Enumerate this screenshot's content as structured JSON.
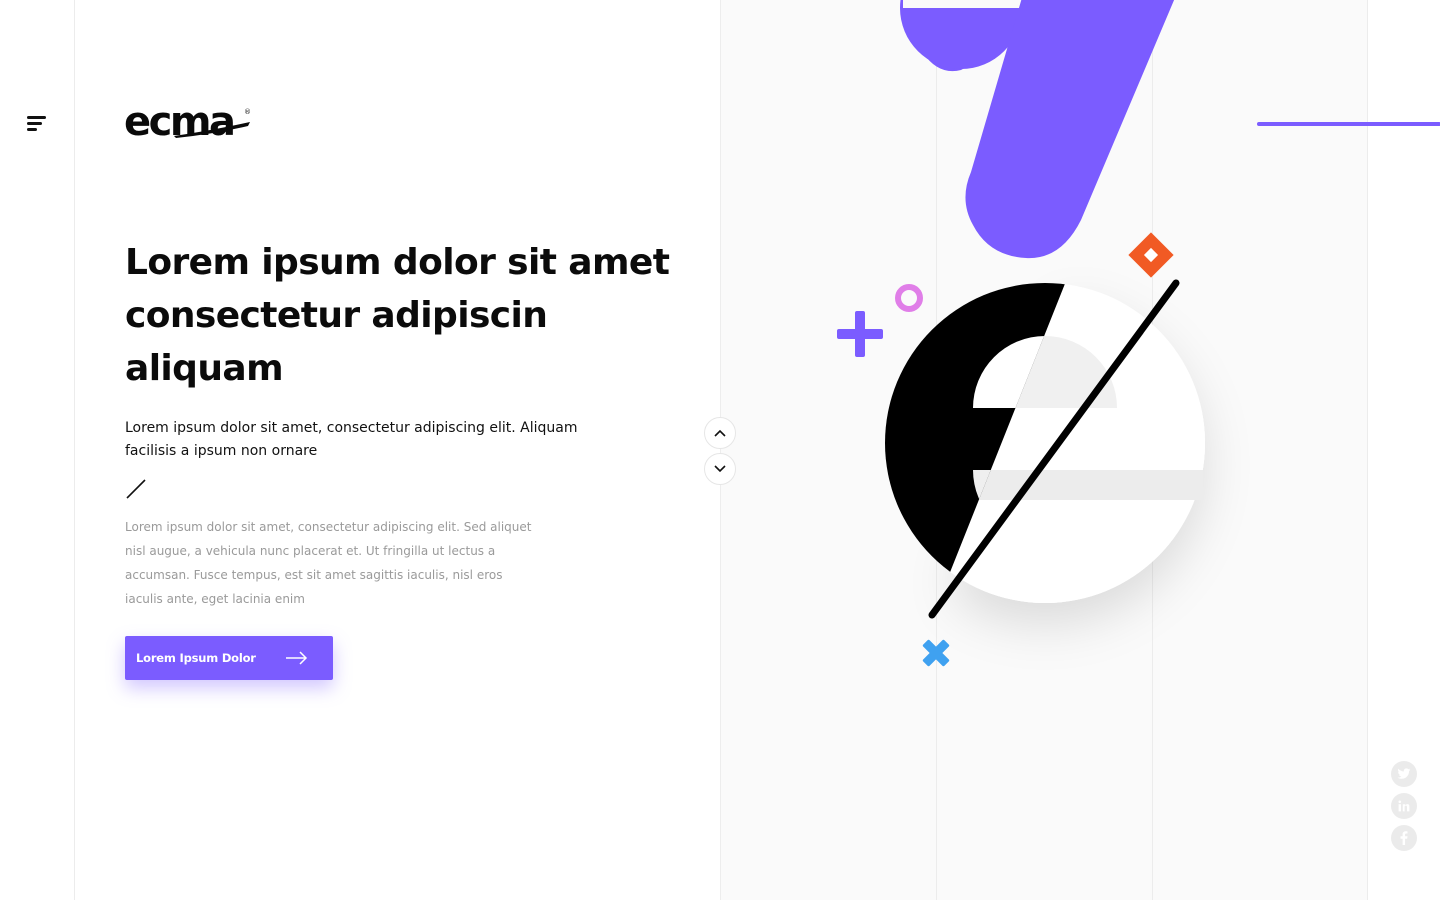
{
  "brand": {
    "logo_text": "ecma",
    "logo_mark": "®",
    "accent_color": "#7b5cff"
  },
  "nav": {
    "menu_icon": "hamburger-menu-icon"
  },
  "hero": {
    "headline_line1": "Lorem ipsum dolor sit amet",
    "headline_line2": "consectetur adipiscin",
    "headline_line3": "aliquam",
    "lead_line1": "Lorem ipsum dolor sit amet, consectetur adipiscing elit. Aliquam",
    "lead_line2": "facilisis a ipsum non ornare",
    "body_line1": "Lorem ipsum dolor sit amet, consectetur adipiscing elit. Sed aliquet",
    "body_line2": "nisl augue, a vehicula nunc placerat et. Ut fringilla ut lectus a",
    "body_line3": "accumsan. Fusce tempus, est sit amet sagittis iaculis, nisl eros",
    "body_line4": "iaculis ante, eget lacinia enim",
    "cta_label": "Lorem Ipsum Dolor"
  },
  "slider": {
    "up_icon": "chevron-up-icon",
    "down_icon": "chevron-down-icon"
  },
  "artwork": {
    "colors": {
      "purple": "#7b5cff",
      "orange": "#f15a24",
      "pink": "#e07ee8",
      "blue": "#3fa1f0",
      "black": "#000000"
    }
  },
  "social": {
    "icons": [
      "twitter-icon",
      "linkedin-icon",
      "facebook-icon"
    ]
  }
}
